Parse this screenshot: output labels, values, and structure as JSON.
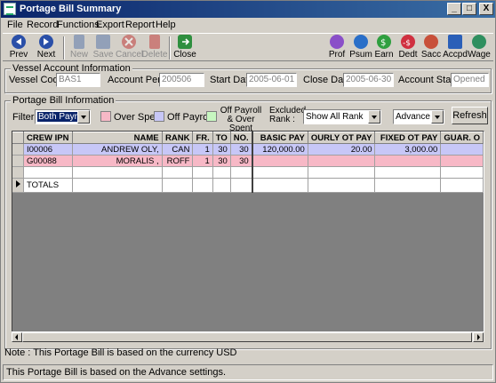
{
  "window": {
    "title": "Portage Bill Summary",
    "controls": {
      "minimize": "_",
      "maximize": "□",
      "close": "X"
    }
  },
  "menu": [
    "File",
    "Record",
    "Functions",
    "Export",
    "Report",
    "Help"
  ],
  "toolbar": {
    "left": [
      {
        "label": "Prev",
        "icon": "prev-arrow-icon",
        "enabled": true,
        "color": "#2a4fa8"
      },
      {
        "label": "Next",
        "icon": "next-arrow-icon",
        "enabled": true,
        "color": "#2a4fa8"
      },
      {
        "label": "New",
        "icon": "new-doc-icon",
        "enabled": false,
        "color": "#4f6fa8"
      },
      {
        "label": "Save",
        "icon": "save-icon",
        "enabled": false,
        "color": "#4f6fa8"
      },
      {
        "label": "Cancel",
        "icon": "cancel-icon",
        "enabled": false,
        "color": "#c03030"
      },
      {
        "label": "Delete",
        "icon": "delete-icon",
        "enabled": false,
        "color": "#c03030"
      },
      {
        "label": "Close",
        "icon": "close-door-icon",
        "enabled": true,
        "color": "#2f8f3f"
      }
    ],
    "right": [
      {
        "label": "Prof",
        "icon": "profile-icon",
        "color": "#8a4fc8"
      },
      {
        "label": "Psum",
        "icon": "summary-icon",
        "color": "#2a6fc8"
      },
      {
        "label": "Earn",
        "icon": "earnings-icon",
        "color": "#2f9f3f"
      },
      {
        "label": "Dedt",
        "icon": "deduction-icon",
        "color": "#d03040"
      },
      {
        "label": "Sacc",
        "icon": "sacc-icon",
        "color": "#c8503a"
      },
      {
        "label": "Accpd",
        "icon": "account-period-icon",
        "color": "#2a5fb8"
      },
      {
        "label": "Wage",
        "icon": "wage-icon",
        "color": "#2f8f5f"
      }
    ]
  },
  "vessel_account": {
    "group_title": "Vessel Account Information",
    "vessel_code_label": "Vessel Code:",
    "vessel_code": "BAS1",
    "account_period_label": "Account Period:",
    "account_period": "200506",
    "start_date_label": "Start Date:",
    "start_date": "2005-06-01",
    "close_date_label": "Close Date:",
    "close_date": "2005-06-30",
    "account_status_label": "Account Status:",
    "account_status": "Opened"
  },
  "portage_bill": {
    "group_title": "Portage Bill Information",
    "filter_label": "Filter :",
    "filter_value": "Both Payroll",
    "legend": [
      {
        "label": "Over Spent",
        "color": "#f7b8c6"
      },
      {
        "label": "Off Payroll",
        "color": "#c7c7f7"
      },
      {
        "label": "Off Payroll & Over Spent",
        "color": "#c7f7c0"
      }
    ],
    "excluded_rank_label": "Excluded Rank :",
    "excluded_rank_value": "Show All Rank",
    "settings_value": "Advance",
    "refresh_label": "Refresh"
  },
  "grid": {
    "columns": [
      "CREW IPN",
      "NAME",
      "RANK",
      "FR.",
      "TO",
      "NO.",
      "BASIC PAY",
      "OURLY OT PAY",
      "FIXED OT PAY",
      "GUAR. O"
    ],
    "rows": [
      {
        "cells": [
          "I00006",
          "ANDREW OLY,",
          "CAN",
          "1",
          "30",
          "30",
          "120,000.00",
          "20.00",
          "3,000.00",
          ""
        ],
        "status": "off-payroll"
      },
      {
        "cells": [
          "G00088",
          "MORALIS ,",
          "ROFF",
          "1",
          "30",
          "30",
          "",
          "",
          "",
          ""
        ],
        "status": "over-spent"
      },
      {
        "cells": [
          "",
          "",
          "",
          "",
          "",
          "",
          "",
          "",
          "",
          ""
        ],
        "status": "blank"
      }
    ],
    "totals_label": "TOTALS"
  },
  "note": "Note : This Portage Bill is based on the currency USD",
  "status_text": "This Portage Bill is based on the Advance settings."
}
